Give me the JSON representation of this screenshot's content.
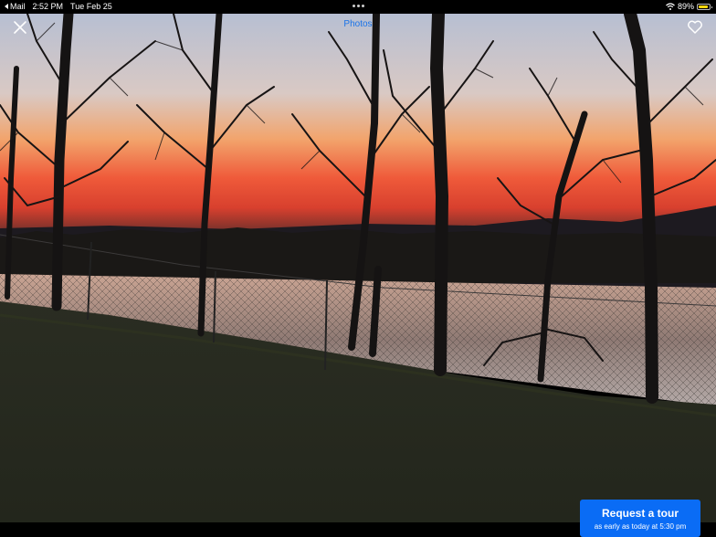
{
  "status_bar": {
    "back_app": "Mail",
    "time": "2:52 PM",
    "date": "Tue Feb 25",
    "battery_percent": "89%",
    "battery_level": 0.89,
    "battery_color": "#ffd60a"
  },
  "header": {
    "photo_tab_label": "Photos"
  },
  "photo": {
    "icons": [
      "close-icon",
      "heart-icon"
    ]
  },
  "cta": {
    "title": "Request a tour",
    "subtitle": "as early as today at 5:30 pm",
    "color": "#0a6cf5"
  }
}
